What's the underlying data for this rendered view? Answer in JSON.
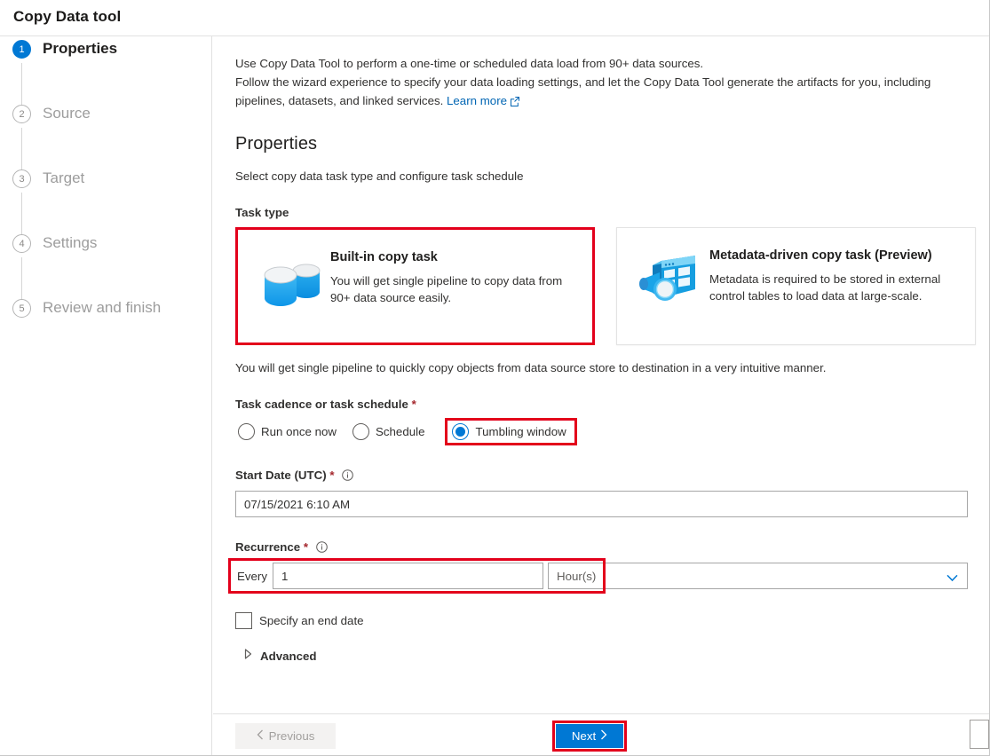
{
  "window": {
    "title": "Copy Data tool"
  },
  "sidebar": {
    "steps": [
      {
        "number": "1",
        "label": "Properties",
        "state": "active"
      },
      {
        "number": "2",
        "label": "Source",
        "state": "inactive"
      },
      {
        "number": "3",
        "label": "Target",
        "state": "inactive"
      },
      {
        "number": "4",
        "label": "Settings",
        "state": "inactive"
      },
      {
        "number": "5",
        "label": "Review and finish",
        "state": "inactive"
      }
    ]
  },
  "intro": {
    "line1": "Use Copy Data Tool to perform a one-time or scheduled data load from 90+ data sources.",
    "line2": "Follow the wizard experience to specify your data loading settings, and let the Copy Data Tool generate the artifacts for you, including",
    "line3": "pipelines, datasets, and linked services.",
    "learn_more": "Learn more",
    "external_link_icon": "external-link-icon"
  },
  "properties": {
    "heading": "Properties",
    "subheading": "Select copy data task type and configure task schedule",
    "task_type_label": "Task type",
    "cards": [
      {
        "title": "Built-in copy task",
        "description": "You will get single pipeline to copy data from 90+ data source easily.",
        "icon": "database-cylinders-icon",
        "selected": true
      },
      {
        "title": "Metadata-driven copy task (Preview)",
        "description": "Metadata is required to be stored in external control tables to load data at large-scale.",
        "icon": "metadata-table-magnifier-icon",
        "selected": false
      }
    ],
    "after_cards_note": "You will get single pipeline to quickly copy objects from data source store to destination in a very intuitive manner.",
    "cadence": {
      "label": "Task cadence or task schedule",
      "required_marker": "*",
      "options": [
        {
          "label": "Run once now",
          "selected": false,
          "highlighted": false
        },
        {
          "label": "Schedule",
          "selected": false,
          "highlighted": false
        },
        {
          "label": "Tumbling window",
          "selected": true,
          "highlighted": true
        }
      ]
    },
    "start_date": {
      "label": "Start Date (UTC)",
      "required_marker": "*",
      "info_icon": "info-icon",
      "value": "07/15/2021 6:10 AM"
    },
    "recurrence": {
      "label": "Recurrence",
      "required_marker": "*",
      "info_icon": "info-icon",
      "every_label": "Every",
      "interval_value": "1",
      "unit_value": "Hour(s)",
      "chevron_icon": "chevron-down-icon",
      "highlighted": true
    },
    "end_date_checkbox": {
      "label": "Specify an end date",
      "checked": false
    },
    "advanced": {
      "label": "Advanced",
      "expanded": false,
      "chevron_icon": "chevron-right-icon"
    }
  },
  "footer": {
    "previous_label": "Previous",
    "previous_icon": "chevron-left-icon",
    "previous_disabled": true,
    "next_label": "Next",
    "next_icon": "chevron-right-icon",
    "next_highlighted": true
  },
  "colors": {
    "accent": "#0078d4",
    "highlight": "#e3001b",
    "required": "#a4262c",
    "link": "#0065b3"
  }
}
